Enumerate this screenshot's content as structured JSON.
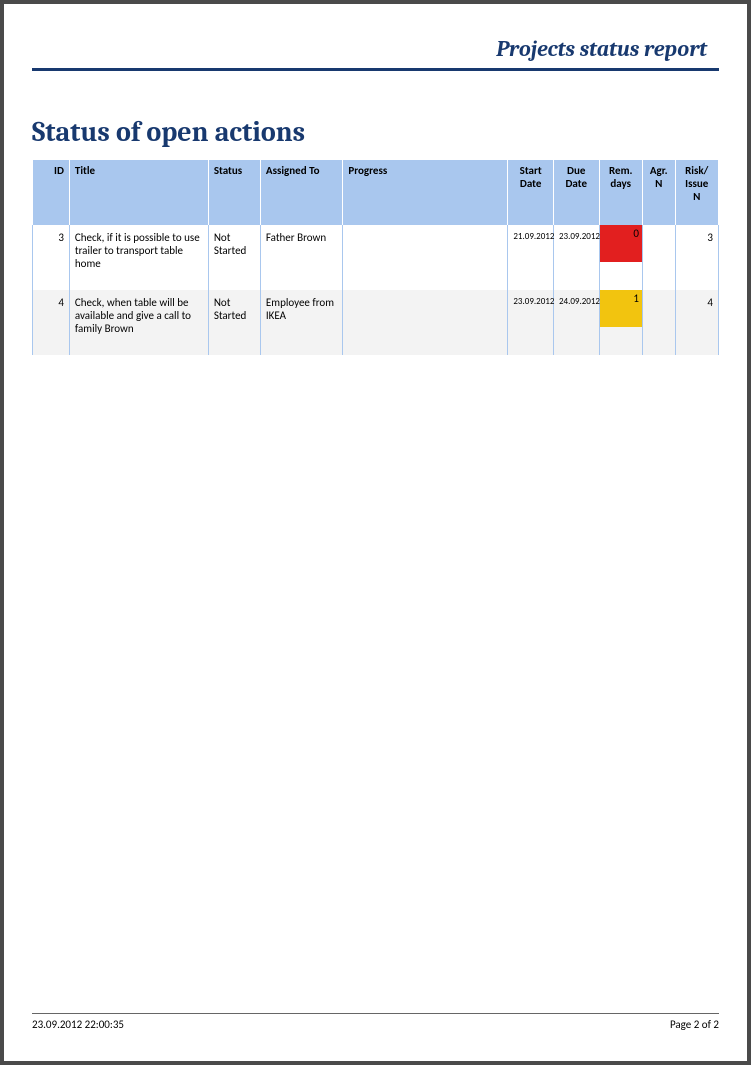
{
  "header": {
    "title": "Projects status report"
  },
  "section": {
    "heading": "Status of open actions"
  },
  "table": {
    "columns": {
      "id": "ID",
      "title": "Title",
      "status": "Status",
      "assigned": "Assigned To",
      "progress": "Progress",
      "start": "Start Date",
      "due": "Due Date",
      "rem": "Rem. days",
      "agr": "Agr. N",
      "risk": "Risk/ Issue N"
    },
    "rows": [
      {
        "id": "3",
        "title": "Check, if it is possible to use trailer to transport table home",
        "status": "Not Started",
        "assigned": "Father Brown",
        "progress": "",
        "start": "21.09.2012",
        "due": "23.09.2012",
        "rem": "0",
        "rem_color": "red",
        "agr": "",
        "risk": "3"
      },
      {
        "id": "4",
        "title": "Check, when table will be available and give a call to family Brown",
        "status": "Not Started",
        "assigned": "Employee from IKEA",
        "progress": "",
        "start": "23.09.2012",
        "due": "24.09.2012",
        "rem": "1",
        "rem_color": "yellow",
        "agr": "",
        "risk": "4"
      }
    ]
  },
  "footer": {
    "timestamp": "23.09.2012 22:00:35",
    "page": "Page 2 of 2"
  }
}
